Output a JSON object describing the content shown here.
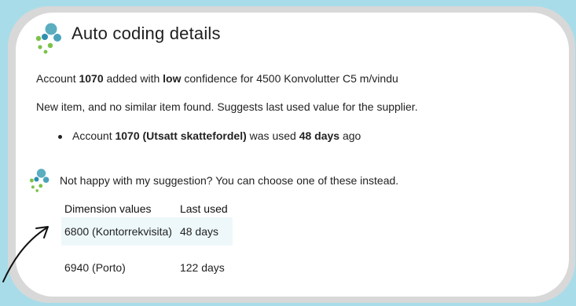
{
  "dialog": {
    "title": "Auto coding details",
    "account_line": {
      "prefix": "Account",
      "account": "1070",
      "mid": "added with",
      "confidence": "low",
      "suffix": "confidence for 4500 Konvolutter C5 m/vindu"
    },
    "reason": "New item, and no similar item found. Suggests last used value for the supplier.",
    "bullet": {
      "prefix": "Account",
      "account": "1070 (Utsatt skattefordel)",
      "mid": "was used",
      "days": "48 days",
      "suffix": "ago"
    },
    "prompt": "Not happy with my suggestion? You can choose one of these instead.",
    "table": {
      "headers": {
        "dimension": "Dimension values",
        "last_used": "Last used"
      },
      "rows": [
        {
          "dimension": "6800 (Kontorrekvisita)",
          "last_used": "48 days"
        },
        {
          "dimension": "6940 (Porto)",
          "last_used": "122 days"
        }
      ]
    }
  },
  "colors": {
    "background": "#a9dce9",
    "logo_teal": "#5aaec0",
    "logo_blue": "#2f8fb0",
    "logo_green": "#7cc24a",
    "row_highlight": "#eef8fa"
  },
  "icons": [
    "assistant-logo-icon",
    "arrow-icon"
  ]
}
